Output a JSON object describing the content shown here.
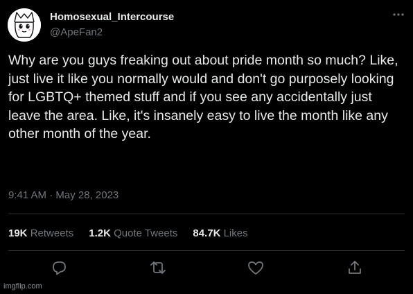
{
  "tweet": {
    "display_name": "Homosexual_Intercourse",
    "handle": "@ApeFan2",
    "text": "Why are you guys freaking out about pride month so much? Like, just live it like you normally would and don't go purposely looking for LGBTQ+ themed stuff and if you see any accidentally just leave the area. Like, it's insanely easy to live the month like any other month of the year.",
    "timestamp": "9:41 AM · May 28, 2023"
  },
  "stats": {
    "retweets": {
      "count": "19K",
      "label": "Retweets"
    },
    "quote_tweets": {
      "count": "1.2K",
      "label": "Quote Tweets"
    },
    "likes": {
      "count": "84.7K",
      "label": "Likes"
    }
  },
  "actions": [
    "reply-icon",
    "retweet-icon",
    "like-icon",
    "share-icon"
  ],
  "icons": {
    "more": "more-icon"
  },
  "colors": {
    "background": "#000000",
    "text": "#e7e9ea",
    "muted": "#71767b",
    "divider": "#2f3336"
  },
  "watermark": "imgflip.com"
}
